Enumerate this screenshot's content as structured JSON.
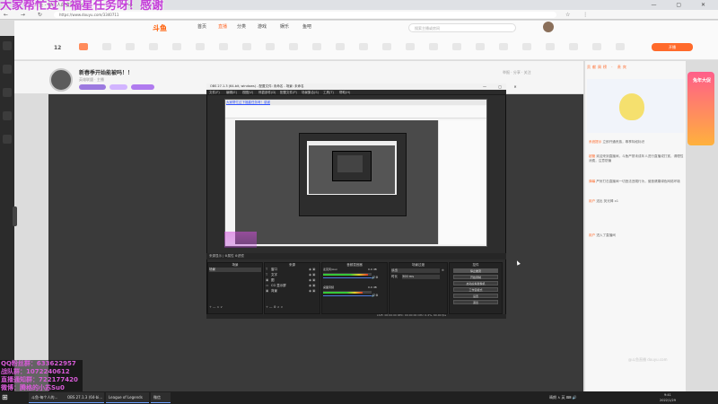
{
  "banner": "大家帮忙过下福星任务呀！感谢",
  "browser": {
    "tab_title": "斗鱼 - 每个人的直播平台",
    "url": "https://www.douyu.com/3340711",
    "window_controls": "— ▢ ✕",
    "nav": "← → ↻",
    "right_icons": "☆ ⋮"
  },
  "site": {
    "logo": "斗鱼",
    "nav": [
      "首页",
      "直播",
      "分类",
      "游戏",
      "娱乐",
      "鱼吧"
    ],
    "search_placeholder": "搜索主播或房间",
    "sub_count": "12",
    "open_btn": "开播"
  },
  "room": {
    "title": "新春季开始能被吗！！",
    "meta": "英雄联盟 · 主播",
    "right": "举报 · 分享 · 关注"
  },
  "obs": {
    "title": "OBS 27.1.3 (64-bit, windows) - 配置文件: 未命名 - 场景: 未命名",
    "menu": [
      "文件(F)",
      "编辑(E)",
      "视图(V)",
      "停靠部件(D)",
      "配置文件(P)",
      "场景集合(S)",
      "工具(T)",
      "帮助(H)"
    ],
    "winctl": "— ▢ ✕",
    "preview_text": "大家帮忙过下福星任务呀！感谢",
    "tab_text": "来源显示    |    ⚙属性    ⚙滤镜",
    "docks": {
      "scenes": "场景",
      "sources": "来源",
      "mixer": "音频混音器",
      "transitions": "场景过渡",
      "controls": "控件"
    },
    "scenes_list": [
      "场景"
    ],
    "sources_list": [
      "窗口",
      "文字",
      "图",
      "CG 显示屏",
      "背景"
    ],
    "mixer_channels": [
      {
        "label": "麦克风/Aux",
        "db": "0.0 dB"
      },
      {
        "label": "桌面音频",
        "db": "0.0 dB"
      }
    ],
    "transition": {
      "type": "淡出",
      "duration_label": "时长",
      "duration": "300 ms"
    },
    "control_buttons": [
      "停止推流",
      "开始录制",
      "启动虚拟摄像机",
      "工作室模式",
      "设置",
      "退出"
    ],
    "status": "LIVE: 00:00:00  REC: 00:00:00  CPU: 0.4%, 60.00 fps"
  },
  "right_panel": {
    "tabs": "贡献周榜  ·  贵宾",
    "ad_text": "兔年大促",
    "chat": [
      {
        "user": "系统提示",
        "text": "立即开通贵族，尊享特权标识"
      },
      {
        "user": "超管",
        "text": "欢迎来到直播间，斗鱼严禁未成年人进行直播或打赏，请理性消费，注意防骗"
      },
      {
        "user": "弹幕",
        "text": "严厉打击直播间一切违法违规行为，营造健康绿色网络环境"
      },
      {
        "user": "用户",
        "text": "送出 荧光棒 x1"
      },
      {
        "user": "用户",
        "text": "进入了直播间"
      }
    ],
    "watermark": "@斗鱼直播 douyu.com"
  },
  "overlay": [
    "QQ粉丝群：633622957",
    "战队群：1072240612",
    "直播通知群：722177420",
    "微博：腾格的小苏Su0"
  ],
  "taskbar": {
    "start": "⊞",
    "items": [
      "斗鱼-每个人的...",
      "OBS 27.1.3 (64-bi...",
      "League of Legends",
      "微信"
    ],
    "tray": "晴朗 ∧ 英 ⌨ 🔊",
    "time": "9:41",
    "date": "2022/1/29"
  },
  "colors": {
    "accent": "#ff6a2b",
    "banner": "#c440d8",
    "obs_dark": "#2d2d2d"
  }
}
